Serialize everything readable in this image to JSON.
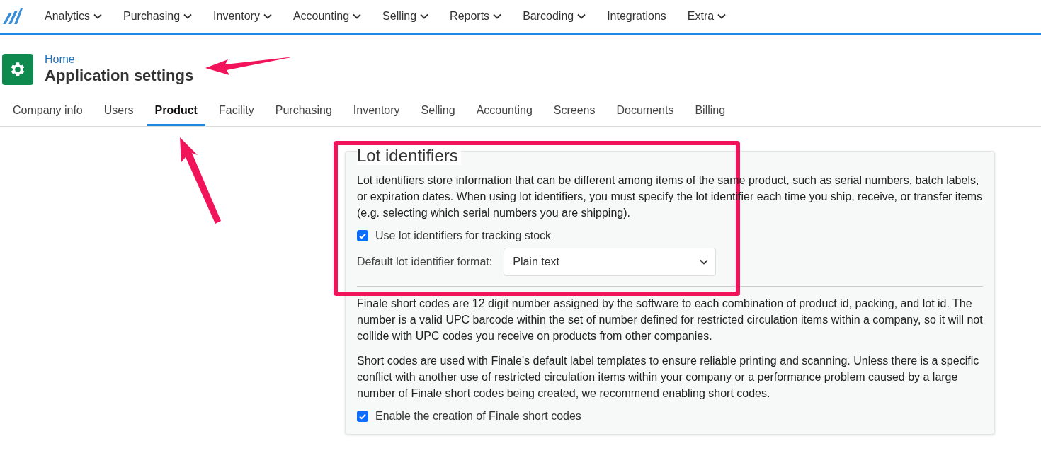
{
  "nav": {
    "items": [
      {
        "label": "Analytics",
        "kind": "dropdown"
      },
      {
        "label": "Purchasing",
        "kind": "dropdown"
      },
      {
        "label": "Inventory",
        "kind": "dropdown"
      },
      {
        "label": "Accounting",
        "kind": "dropdown"
      },
      {
        "label": "Selling",
        "kind": "dropdown"
      },
      {
        "label": "Reports",
        "kind": "dropdown"
      },
      {
        "label": "Barcoding",
        "kind": "dropdown"
      },
      {
        "label": "Integrations",
        "kind": "link"
      },
      {
        "label": "Extra",
        "kind": "dropdown"
      }
    ]
  },
  "header": {
    "breadcrumb": "Home",
    "title": "Application settings"
  },
  "tabs": [
    {
      "label": "Company info",
      "selected": false
    },
    {
      "label": "Users",
      "selected": false
    },
    {
      "label": "Product",
      "selected": true
    },
    {
      "label": "Facility",
      "selected": false
    },
    {
      "label": "Purchasing",
      "selected": false
    },
    {
      "label": "Inventory",
      "selected": false
    },
    {
      "label": "Selling",
      "selected": false
    },
    {
      "label": "Accounting",
      "selected": false
    },
    {
      "label": "Screens",
      "selected": false
    },
    {
      "label": "Documents",
      "selected": false
    },
    {
      "label": "Billing",
      "selected": false
    }
  ],
  "panel": {
    "legend": "Lot identifiers",
    "lot_description": "Lot identifiers store information that can be different among items of the same product, such as serial numbers, batch labels, or expiration dates. When using lot identifiers, you must specify the lot identifier each time you ship, receive, or transfer items (e.g. selecting which serial numbers you are shipping).",
    "lot_checkbox": {
      "label": "Use lot identifiers for tracking stock",
      "checked": true
    },
    "format_field": {
      "label": "Default lot identifier format:",
      "value": "Plain text"
    },
    "short_code_paragraphs": [
      "Finale short codes are 12 digit number assigned by the software to each combination of product id, packing, and lot id. The number is a valid UPC barcode within the set of number defined for restricted circulation items within a company, so it will not collide with UPC codes you receive on products from other companies.",
      "Short codes are used with Finale's default label templates to ensure reliable printing and scanning. Unless there is a specific conflict with another use of restricted circulation items within your company or a performance problem caused by a large number of Finale short codes being created, we recommend enabling short codes."
    ],
    "short_code_checkbox": {
      "label": "Enable the creation of Finale short codes",
      "checked": true
    }
  }
}
